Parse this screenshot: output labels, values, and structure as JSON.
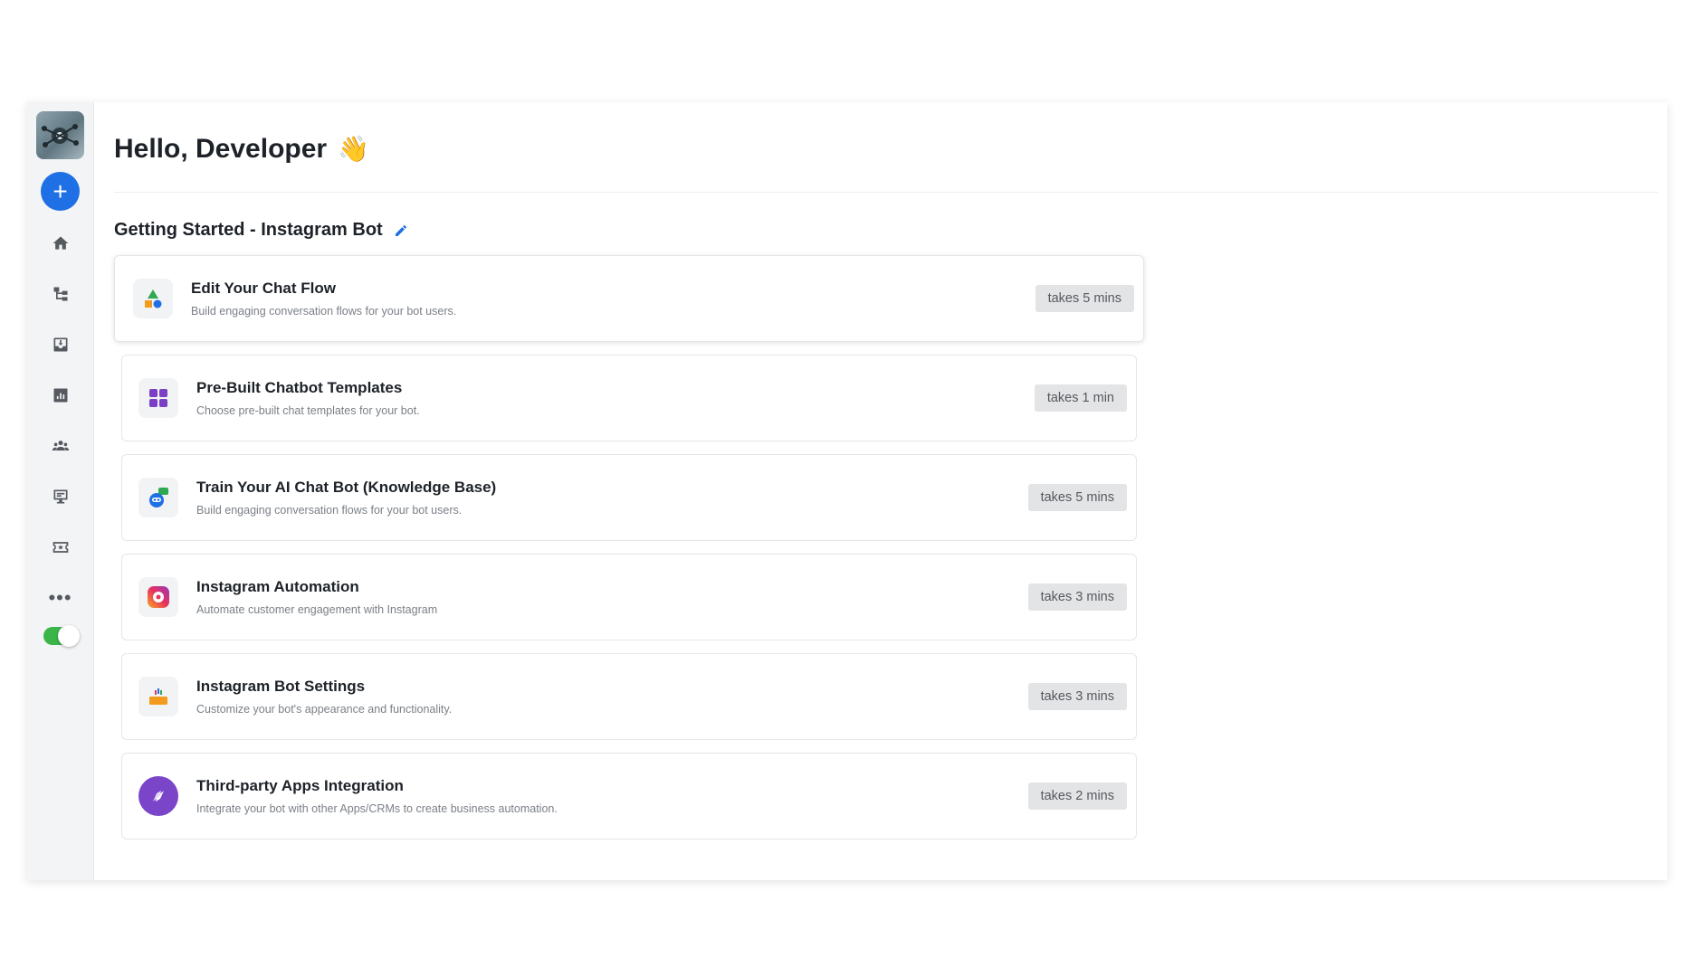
{
  "greeting": {
    "text": "Hello, Developer",
    "emoji": "👋"
  },
  "section": {
    "title": "Getting Started - Instagram Bot"
  },
  "sidebar": {
    "icons": [
      "avatar",
      "add-icon",
      "home-icon",
      "flow-icon",
      "inbox-icon",
      "analytics-icon",
      "audience-icon",
      "broadcast-icon",
      "ticket-icon",
      "more-icon",
      "toggle"
    ],
    "add_label": "+",
    "more_label": "•••",
    "toggle_on": true
  },
  "cards": [
    {
      "title": "Edit Your Chat Flow",
      "subtitle": "Build engaging conversation flows for your bot users.",
      "time": "takes 5 mins",
      "icon": "shapes-icon"
    },
    {
      "title": "Pre-Built Chatbot Templates",
      "subtitle": "Choose pre-built chat templates for your bot.",
      "time": "takes 1 min",
      "icon": "grid-icon"
    },
    {
      "title": "Train Your AI Chat Bot (Knowledge Base)",
      "subtitle": "Build engaging conversation flows for your bot users.",
      "time": "takes 5 mins",
      "icon": "ai-bot-icon"
    },
    {
      "title": "Instagram Automation",
      "subtitle": "Automate customer engagement with Instagram",
      "time": "takes 3 mins",
      "icon": "instagram-gear-icon"
    },
    {
      "title": "Instagram Bot Settings",
      "subtitle": "Customize your bot's appearance and functionality.",
      "time": "takes 3 mins",
      "icon": "bot-settings-icon"
    },
    {
      "title": "Third-party Apps Integration",
      "subtitle": "Integrate your bot with other Apps/CRMs to create business automation.",
      "time": "takes 2 mins",
      "icon": "compass-icon"
    }
  ],
  "colors": {
    "accent": "#1f6fe5",
    "toggle": "#3bb54a",
    "badge_bg": "#e3e4e6"
  }
}
